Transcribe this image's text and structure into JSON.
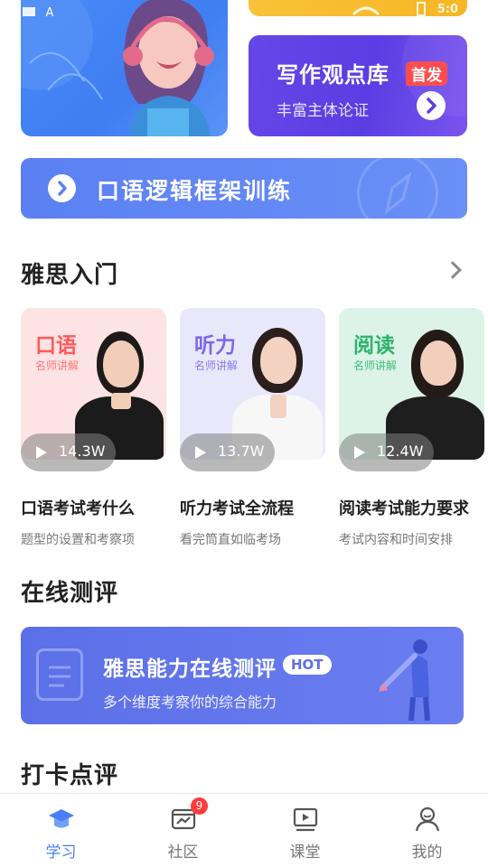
{
  "writing_card": {
    "title": "写作观点库",
    "badge": "首发",
    "subtitle": "丰富主体论证"
  },
  "top_strip": {
    "status_text": "5:0"
  },
  "logic_banner": {
    "title": "口语逻辑框架训练"
  },
  "intro_section": {
    "title": "雅思入门"
  },
  "courses": [
    {
      "tag": "口语",
      "teacher": "名师讲解",
      "plays": "14.3W",
      "title": "口语考试考什么",
      "desc": "题型的设置和考察项",
      "bg": "#fde3e3",
      "tag_color": "#ff5a5a",
      "teacher_color": "#ff7a7a"
    },
    {
      "tag": "听力",
      "teacher": "名师讲解",
      "plays": "13.7W",
      "title": "听力考试全流程",
      "desc": "看完筒直如临考场",
      "bg": "#e9e8fb",
      "tag_color": "#7b68e8",
      "teacher_color": "#8b7be8"
    },
    {
      "tag": "阅读",
      "teacher": "名师讲解",
      "plays": "12.4W",
      "title": "阅读考试能力要求",
      "desc": "考试内容和时间安排",
      "bg": "#ddf3e8",
      "tag_color": "#2fb36b",
      "teacher_color": "#3fbf79"
    }
  ],
  "eval_section": {
    "title": "在线测评"
  },
  "eval_card": {
    "title": "雅思能力在线测评",
    "hot": "HOT",
    "subtitle": "多个维度考察你的综合能力"
  },
  "checkin_section": {
    "title": "打卡点评"
  },
  "tabbar": {
    "items": [
      {
        "label": "学习",
        "icon": "graduation-cap-icon",
        "active": true
      },
      {
        "label": "社区",
        "icon": "community-chart-icon",
        "badge": "9"
      },
      {
        "label": "课堂",
        "icon": "video-play-icon"
      },
      {
        "label": "我的",
        "icon": "user-profile-icon"
      }
    ]
  },
  "colors": {
    "accent": "#4a7ef6",
    "badge_red": "#ff3b3b",
    "writing_purple": "#5a3ee3",
    "eval_blue": "#5b6fe8"
  }
}
